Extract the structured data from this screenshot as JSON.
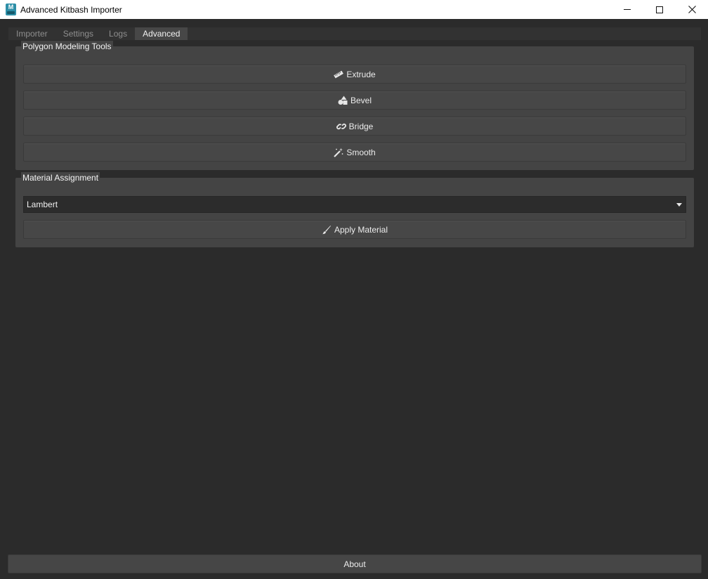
{
  "window": {
    "title": "Advanced Kitbash Importer",
    "app_icon_letter": "M",
    "controls": [
      "minimize-icon",
      "maximize-icon",
      "close-icon"
    ]
  },
  "tabs": [
    {
      "label": "Importer",
      "active": false
    },
    {
      "label": "Settings",
      "active": false
    },
    {
      "label": "Logs",
      "active": false
    },
    {
      "label": "Advanced",
      "active": true
    }
  ],
  "polygon_tools": {
    "title": "Polygon Modeling Tools",
    "buttons": [
      {
        "label": "Extrude",
        "icon": "ruler-icon"
      },
      {
        "label": "Bevel",
        "icon": "shapes-icon"
      },
      {
        "label": "Bridge",
        "icon": "link-icon"
      },
      {
        "label": "Smooth",
        "icon": "magic-wand-icon"
      }
    ]
  },
  "material": {
    "title": "Material Assignment",
    "selected": "Lambert",
    "apply_label": "Apply Material",
    "apply_icon": "paint-brush-icon"
  },
  "footer": {
    "about_label": "About"
  },
  "colors": {
    "background": "#2b2b2b",
    "panel": "#444444",
    "button": "#474747",
    "active_tab": "#474747",
    "text": "#e6e6e6"
  }
}
